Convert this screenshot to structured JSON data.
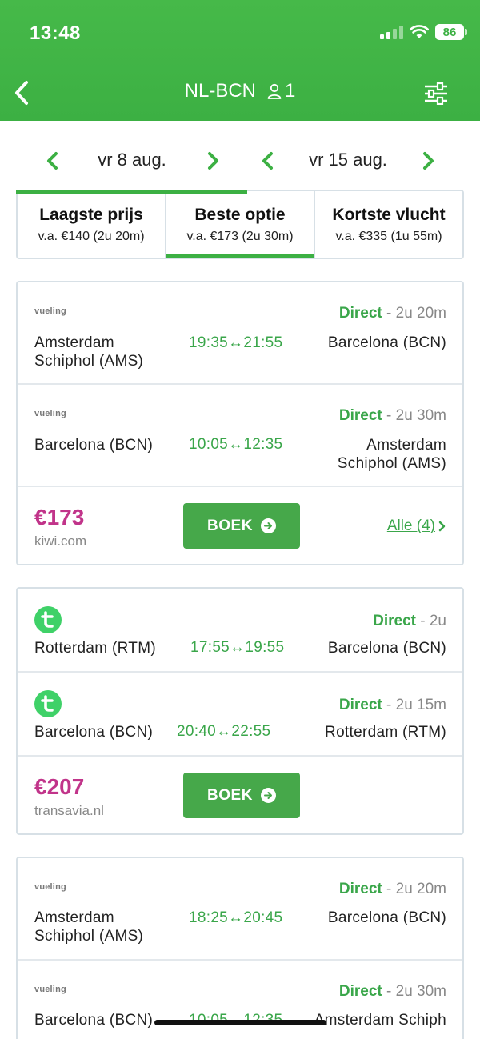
{
  "status_bar": {
    "time": "13:48",
    "battery": "86"
  },
  "nav": {
    "route": "NL-BCN",
    "passengers": "1"
  },
  "dates": {
    "outbound": "vr 8 aug.",
    "return": "vr 15 aug."
  },
  "tabs": [
    {
      "title": "Laagste prijs",
      "sub": "v.a. €140 (2u 20m)"
    },
    {
      "title": "Beste optie",
      "sub": "v.a. €173 (2u 30m)"
    },
    {
      "title": "Kortste vlucht",
      "sub": "v.a. €335 (1u 55m)"
    }
  ],
  "results": [
    {
      "legs": [
        {
          "airline": "vueling",
          "type": "Direct",
          "duration": "2u 20m",
          "from": "Amsterdam\nSchiphol (AMS)",
          "times": "19:35↔21:55",
          "to": "Barcelona (BCN)"
        },
        {
          "airline": "vueling",
          "type": "Direct",
          "duration": "2u 30m",
          "from": "Barcelona (BCN)",
          "times": "10:05↔12:35",
          "to": "Amsterdam\nSchiphol (AMS)"
        }
      ],
      "price": "€173",
      "vendor": "kiwi.com",
      "book": "BOEK",
      "more": "Alle (4)"
    },
    {
      "legs": [
        {
          "airline": "transavia",
          "type": "Direct",
          "duration": "2u",
          "from": "Rotterdam (RTM)",
          "times": "17:55↔19:55",
          "to": "Barcelona (BCN)"
        },
        {
          "airline": "transavia",
          "type": "Direct",
          "duration": "2u 15m",
          "from": "Barcelona (BCN)",
          "times": "20:40↔22:55",
          "to": "Rotterdam (RTM)"
        }
      ],
      "price": "€207",
      "vendor": "transavia.nl",
      "book": "BOEK"
    },
    {
      "legs": [
        {
          "airline": "vueling",
          "type": "Direct",
          "duration": "2u 20m",
          "from": "Amsterdam\nSchiphol (AMS)",
          "times": "18:25↔20:45",
          "to": "Barcelona (BCN)"
        },
        {
          "airline": "vueling",
          "type": "Direct",
          "duration": "2u 30m",
          "from": "Barcelona (BCN)",
          "times": "10:05↔12:35",
          "to": "Amsterdam Schiph"
        }
      ]
    }
  ],
  "colors": {
    "brand_green": "#3cb043",
    "price_magenta": "#c1348a",
    "time_green": "#3aa64a"
  }
}
